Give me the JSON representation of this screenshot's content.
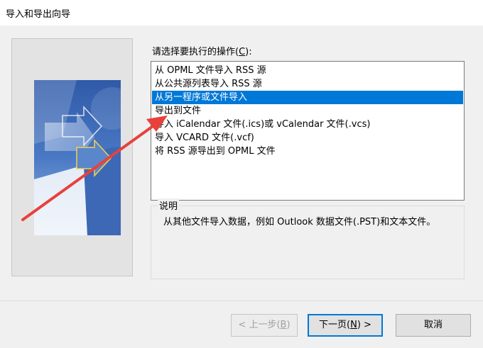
{
  "window": {
    "title": "导入和导出向导"
  },
  "prompt": {
    "label": "请选择要执行的操作(",
    "mnemonic": "C",
    "suffix": "):"
  },
  "actions": [
    {
      "label": "从 OPML 文件导入 RSS 源"
    },
    {
      "label": "从公共源列表导入 RSS 源"
    },
    {
      "label": "从另一程序或文件导入",
      "selected": true
    },
    {
      "label": "导出到文件"
    },
    {
      "label": "导入 iCalendar 文件(.ics)或 vCalendar 文件(.vcs)"
    },
    {
      "label": "导入 VCARD 文件(.vcf)"
    },
    {
      "label": "将 RSS 源导出到 OPML 文件"
    }
  ],
  "description": {
    "legend": "说明",
    "text": "从其他文件导入数据，例如 Outlook 数据文件(.PST)和文本文件。"
  },
  "buttons": {
    "back": {
      "pre": "< 上一步(",
      "key": "B",
      "post": ")"
    },
    "next": {
      "pre": "下一页(",
      "key": "N",
      "post": ") >"
    },
    "cancel": "取消"
  },
  "colors": {
    "selection": "#0078d7",
    "annotation_arrow": "#e8413c"
  }
}
